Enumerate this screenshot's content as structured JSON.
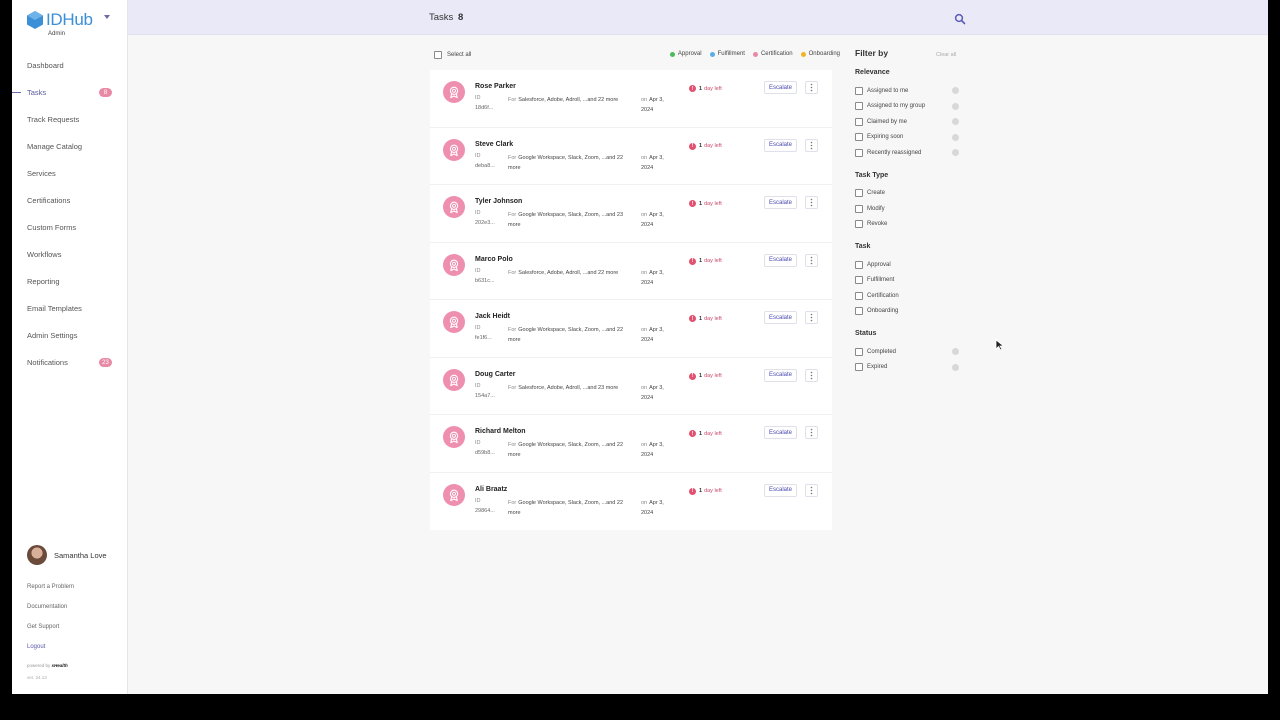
{
  "app": {
    "logo_text": "IDHub",
    "logo_sub": "Admin",
    "colors": {
      "accent": "#5a5aa8",
      "pink": "#ef8fb0",
      "header_bg": "#e9e9f8",
      "danger": "#e0506f"
    }
  },
  "sidebar": {
    "items": [
      {
        "label": "Dashboard",
        "badge": ""
      },
      {
        "label": "Tasks",
        "badge": "8"
      },
      {
        "label": "Track Requests",
        "badge": ""
      },
      {
        "label": "Manage Catalog",
        "badge": ""
      },
      {
        "label": "Services",
        "badge": ""
      },
      {
        "label": "Certifications",
        "badge": ""
      },
      {
        "label": "Custom Forms",
        "badge": ""
      },
      {
        "label": "Workflows",
        "badge": ""
      },
      {
        "label": "Reporting",
        "badge": ""
      },
      {
        "label": "Email Templates",
        "badge": ""
      },
      {
        "label": "Admin Settings",
        "badge": ""
      },
      {
        "label": "Notifications",
        "badge": "23"
      }
    ],
    "user_name": "Samantha Love",
    "links": [
      "Report a Problem",
      "Documentation",
      "Get Support",
      "Logout"
    ],
    "powered_label": "powered by",
    "powered_brand": "sHealth",
    "version": "ver. 24.13"
  },
  "header": {
    "title": "Tasks",
    "count": "8",
    "search_icon": "search-icon"
  },
  "list": {
    "select_all": "Select all",
    "legend": [
      {
        "label": "Approval",
        "color": "#4cbb5a"
      },
      {
        "label": "Fulfillment",
        "color": "#5aaee8"
      },
      {
        "label": "Certification",
        "color": "#e88aa5"
      },
      {
        "label": "Onboarding",
        "color": "#f0b429"
      }
    ],
    "id_label": "ID",
    "for_label": "For",
    "on_label": "on",
    "escalate_label": "Escalate",
    "due_count": "1",
    "due_text": "day left",
    "tasks": [
      {
        "name": "Rose Parker",
        "id": "18d6f...",
        "for": "Salesforce, Adobe, Adroll, ...and 22 more",
        "date": "Apr 3, 2024"
      },
      {
        "name": "Steve Clark",
        "id": "deba8...",
        "for": "Google Workspace, Slack, Zoom, ...and 22 more",
        "date": "Apr 3, 2024"
      },
      {
        "name": "Tyler Johnson",
        "id": "202e3...",
        "for": "Google Workspace, Slack, Zoom, ...and 23 more",
        "date": "Apr 3, 2024"
      },
      {
        "name": "Marco Polo",
        "id": "b631c...",
        "for": "Salesforce, Adobe, Adroll, ...and 22 more",
        "date": "Apr 3, 2024"
      },
      {
        "name": "Jack Heidt",
        "id": "fe1f6...",
        "for": "Google Workspace, Slack, Zoom, ...and 22 more",
        "date": "Apr 3, 2024"
      },
      {
        "name": "Doug Carter",
        "id": "154a7...",
        "for": "Salesforce, Adobe, Adroll, ...and 23 more",
        "date": "Apr 3, 2024"
      },
      {
        "name": "Richard Melton",
        "id": "d59b8...",
        "for": "Google Workspace, Slack, Zoom, ...and 22 more",
        "date": "Apr 3, 2024"
      },
      {
        "name": "Ali Braatz",
        "id": "29864...",
        "for": "Google Workspace, Slack, Zoom, ...and 22 more",
        "date": "Apr 3, 2024"
      }
    ]
  },
  "filter": {
    "title": "Filter by",
    "clear_all": "Clear all",
    "sections": [
      {
        "title": "Relevance",
        "info": true,
        "options": [
          "Assigned to me",
          "Assigned to my group",
          "Claimed by me",
          "Expiring soon",
          "Recently reassigned"
        ]
      },
      {
        "title": "Task Type",
        "info": false,
        "options": [
          "Create",
          "Modify",
          "Revoke"
        ]
      },
      {
        "title": "Task",
        "info": false,
        "options": [
          "Approval",
          "Fulfillment",
          "Certification",
          "Onboarding"
        ]
      },
      {
        "title": "Status",
        "info": true,
        "options": [
          "Completed",
          "Expired"
        ]
      }
    ]
  }
}
